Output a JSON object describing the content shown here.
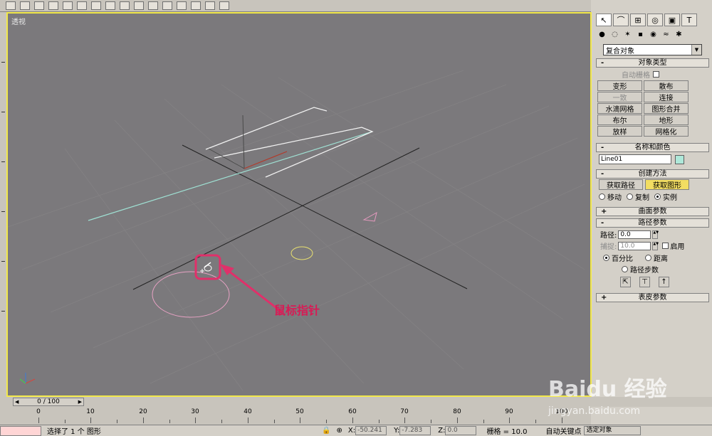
{
  "viewport": {
    "label": "透视"
  },
  "callout": {
    "label": "鼠标指针"
  },
  "panel": {
    "tabs": [
      "arrow-icon",
      "arc-icon",
      "hierarchy-icon",
      "motion-icon",
      "display-icon",
      "utilities-icon"
    ],
    "category_dropdown": "复合对象",
    "object_type": {
      "header": "对象类型",
      "autogrid": "自动栅格",
      "buttons": [
        "变形",
        "散布",
        "一致",
        "连接",
        "水滴网格",
        "图形合并",
        "布尔",
        "地形",
        "放样",
        "网格化"
      ]
    },
    "name_color": {
      "header": "名称和颜色",
      "name": "Line01",
      "swatch_color": "#aee8d9"
    },
    "creation_method": {
      "header": "创建方法",
      "get_path": "获取路径",
      "get_shape": "获取图形",
      "move": "移动",
      "copy": "复制",
      "instance": "实例"
    },
    "surface_params": {
      "header": "曲面参数"
    },
    "path_params": {
      "header": "路径参数",
      "path_label": "路径:",
      "path_value": "0.0",
      "snap_label": "捕捉:",
      "snap_value": "10.0",
      "enable": "启用",
      "percent": "百分比",
      "distance": "距离",
      "path_steps": "路径步数"
    },
    "skin_params": {
      "header": "表皮参数"
    }
  },
  "timeline": {
    "slider": "0 / 100",
    "labels": [
      "0",
      "10",
      "20",
      "30",
      "40",
      "50",
      "60",
      "70",
      "80",
      "90",
      "100"
    ]
  },
  "status": {
    "selected": "选择了 1 个 图形",
    "x_label": "X:",
    "x_value": "-50.241",
    "y_label": "Y:",
    "y_value": "-7.283",
    "z_label": "Z:",
    "z_value": "0.0",
    "grid": "栅格 = 10.0",
    "auto_key": "自动关键点",
    "selection": "选定对象"
  },
  "watermark": {
    "brand": "Baidu 经验",
    "url": "jingyan.baidu.com"
  }
}
